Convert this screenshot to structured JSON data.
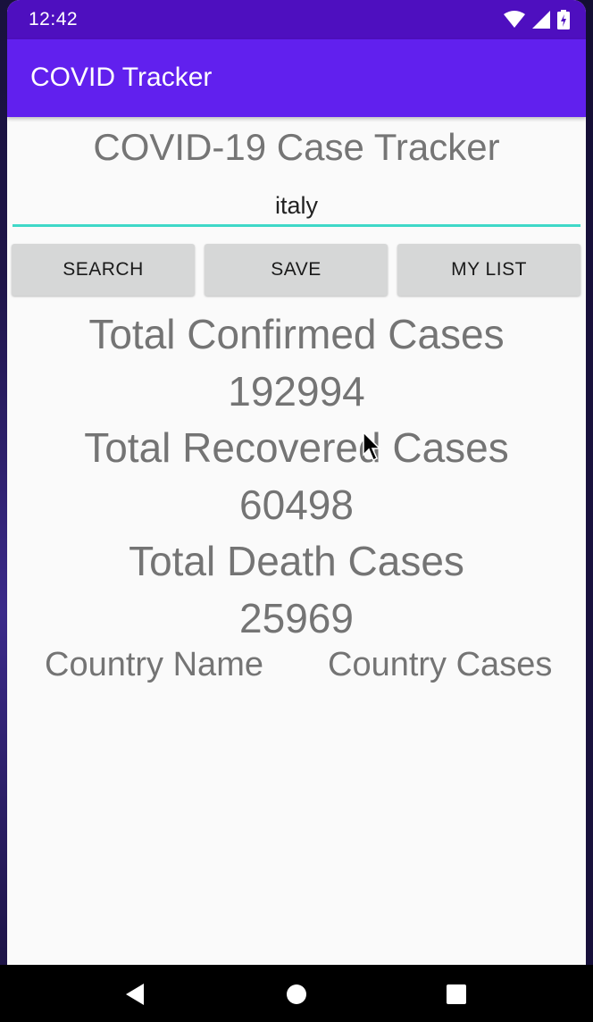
{
  "status_bar": {
    "time": "12:42",
    "icons": [
      "wifi-icon",
      "signal-icon",
      "battery-icon"
    ],
    "background": "#4e0fbf"
  },
  "app_bar": {
    "title": "COVID Tracker",
    "background": "#6120ee"
  },
  "main": {
    "heading": "COVID-19 Case Tracker",
    "search": {
      "value": "italy",
      "placeholder": ""
    },
    "buttons": {
      "search": "SEARCH",
      "save": "SAVE",
      "my_list": "MY LIST"
    },
    "stats": {
      "confirmed_label": "Total Confirmed Cases",
      "confirmed_value": "192994",
      "recovered_label": "Total Recovered Cases",
      "recovered_value": "60498",
      "deaths_label": "Total Death Cases",
      "deaths_value": "25969"
    },
    "list_headers": {
      "country_name": "Country Name",
      "country_cases": "Country Cases"
    }
  },
  "colors": {
    "accent_underline": "#3fd8c8",
    "button_bg": "#d6d7d7",
    "text_gray": "#747474"
  },
  "nav_bar": {
    "icons": [
      "back-icon",
      "home-icon",
      "recents-icon"
    ]
  }
}
